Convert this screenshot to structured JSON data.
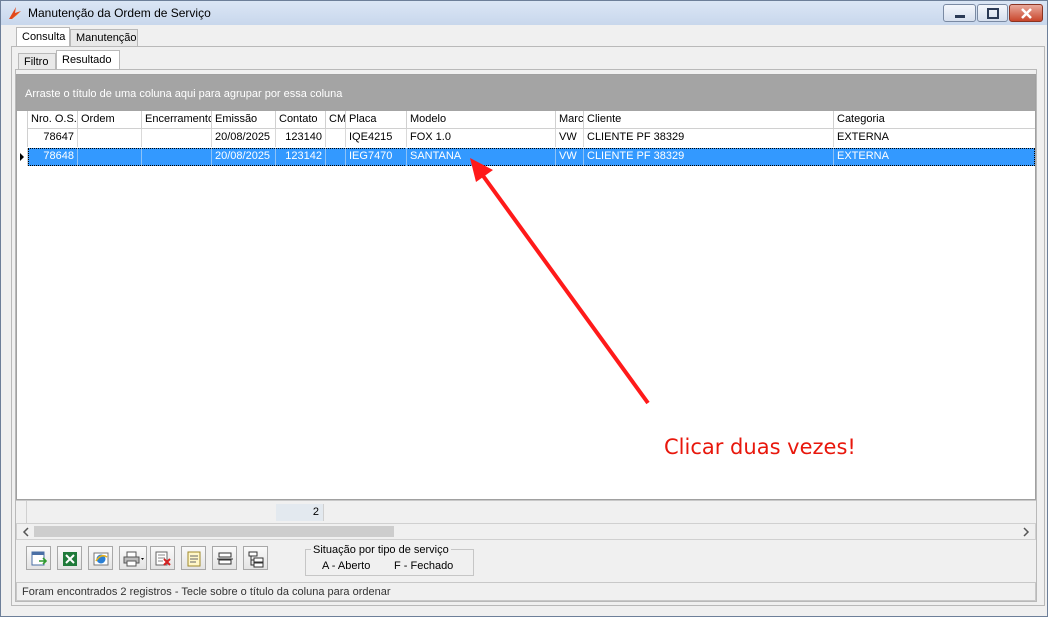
{
  "window": {
    "title": "Manutenção da Ordem de Serviço"
  },
  "top_tabs": [
    {
      "label": "Consulta",
      "active": true
    },
    {
      "label": "Manutenção",
      "active": false
    }
  ],
  "sub_tabs": [
    {
      "label": "Filtro",
      "active": false
    },
    {
      "label": "Resultado",
      "active": true
    }
  ],
  "grid": {
    "group_hint": "Arraste o título de uma coluna aqui para agrupar por essa coluna",
    "columns": [
      "Nro. O.S.",
      "Ordem",
      "Encerramento",
      "Emissão",
      "Contato",
      "CM",
      "Placa",
      "Modelo",
      "Marc",
      "Cliente",
      "Categoria"
    ],
    "rows": [
      {
        "selected": false,
        "cells": [
          "78647",
          "",
          "",
          "20/08/2025",
          "123140",
          "",
          "IQE4215",
          "FOX 1.0",
          "VW",
          "CLIENTE PF 38329",
          "EXTERNA"
        ]
      },
      {
        "selected": true,
        "cells": [
          "78648",
          "",
          "",
          "20/08/2025",
          "123142",
          "",
          "IEG7470",
          "SANTANA",
          "VW",
          "CLIENTE PF 38329",
          "EXTERNA"
        ]
      }
    ],
    "footer_count": "2"
  },
  "toolbar": {
    "icons": [
      "export-icon",
      "excel-icon",
      "browser-icon",
      "print-icon",
      "delete-doc-icon",
      "document-icon",
      "collapse-icon",
      "expand-icon"
    ]
  },
  "legend": {
    "title": "Situação por tipo de serviço",
    "a": "A - Aberto",
    "f": "F - Fechado"
  },
  "status": {
    "text": "Foram encontrados 2 registros  - Tecle sobre o título da coluna para ordenar"
  },
  "annotation": {
    "text": "Clicar duas vezes!",
    "color": "#e8170c"
  },
  "colors": {
    "selection": "#3399ff",
    "group_bar": "#a4a4a4"
  }
}
